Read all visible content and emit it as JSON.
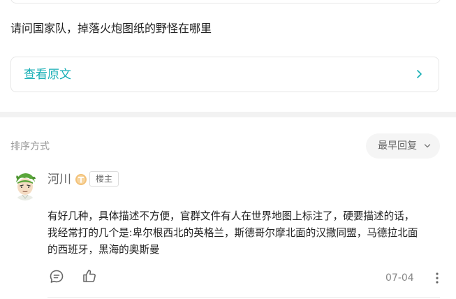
{
  "question": {
    "text": "请问国家队，掉落火炮图纸的野怪在哪里"
  },
  "view_original": {
    "label": "查看原文",
    "icon": "chevron-right-icon"
  },
  "sort": {
    "label": "排序方式",
    "selected": "最早回复",
    "icon": "chevron-down-icon"
  },
  "comment": {
    "author": "河川",
    "level_badge_icon": "level-badge-icon",
    "op_badge": "楼主",
    "lines": [
      "有好几种，具体描述不方便，官群文件有人在世界地图上标注了，硬要描述的话，",
      "我经常打的几个是:卑尔根西北的英格兰，斯德哥尔摩北面的汉撒同盟，马德拉北面",
      "的西班牙，黑海的奥斯曼"
    ],
    "date": "07-04",
    "actions": {
      "reply_icon": "comment-bubble-icon",
      "like_icon": "thumbs-up-icon",
      "more_icon": "more-vertical-icon"
    }
  },
  "colors": {
    "accent": "#16aeb5",
    "text": "#222222",
    "muted": "#999999",
    "badge_gold": "#f3c27a"
  }
}
